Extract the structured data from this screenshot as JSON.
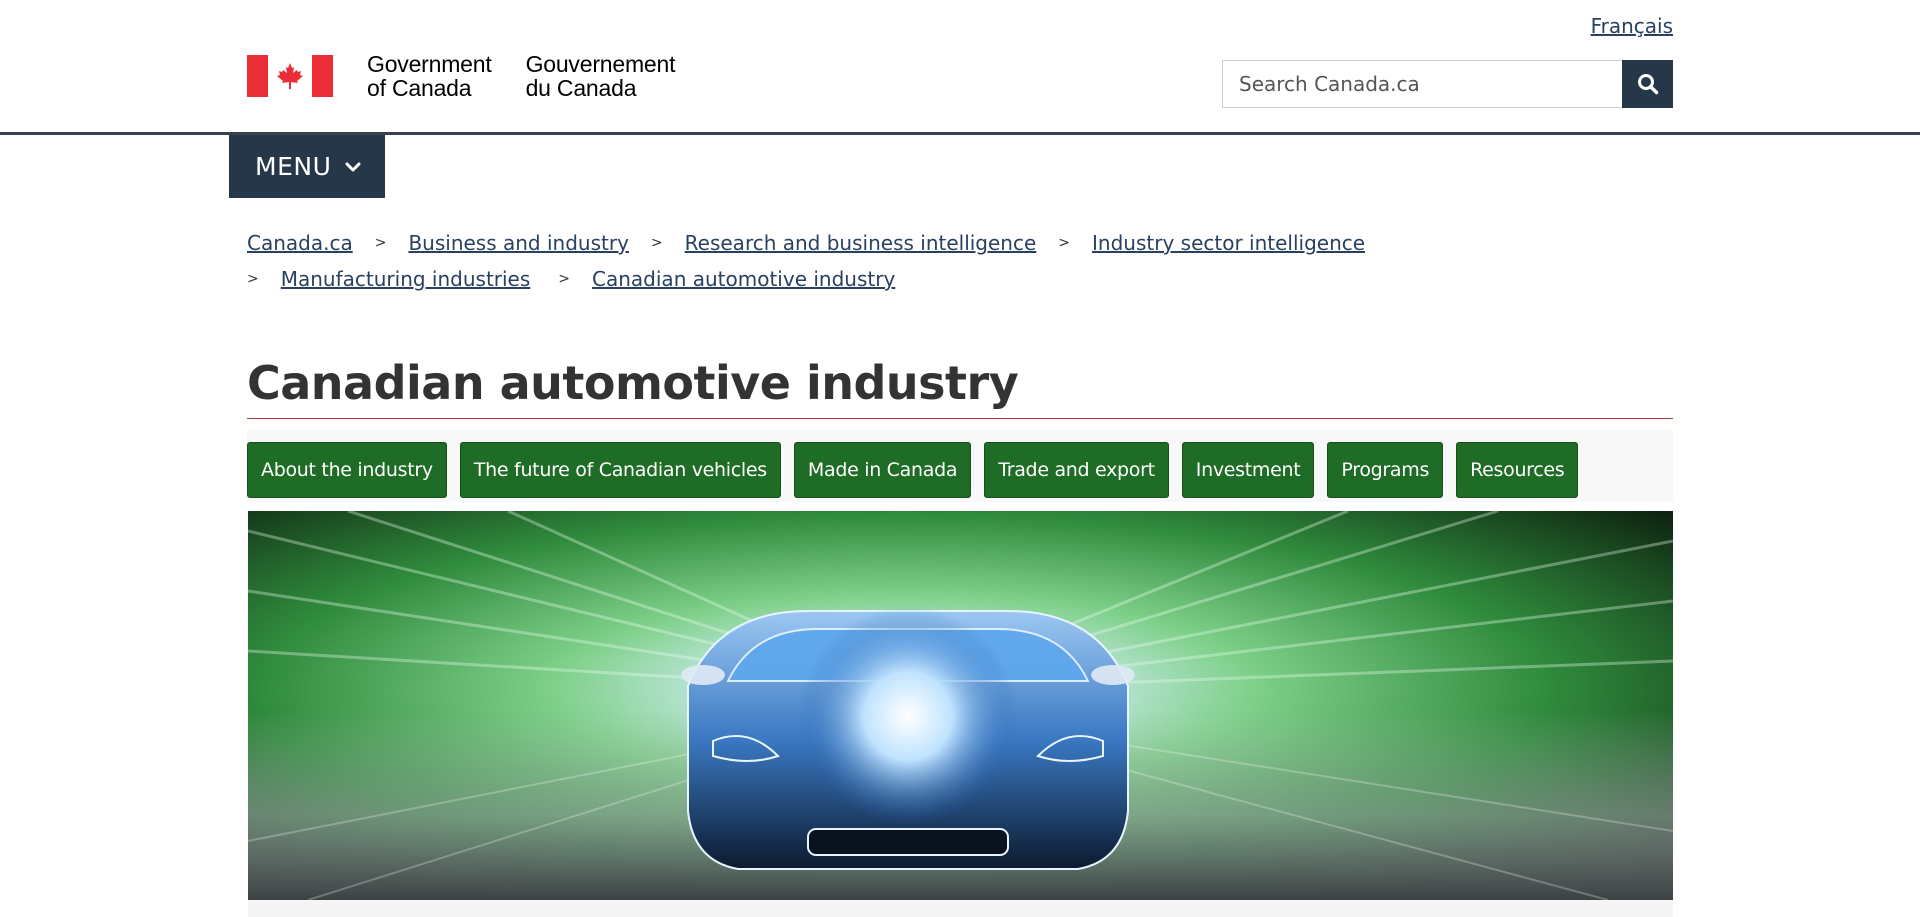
{
  "header": {
    "language_link": "Français",
    "signature_en_line1": "Government",
    "signature_en_line2": "of Canada",
    "signature_fr_line1": "Gouvernement",
    "signature_fr_line2": "du Canada",
    "search_placeholder": "Search Canada.ca",
    "search_icon": "search-icon",
    "colors": {
      "flag_red": "#eb2d37",
      "nav_dark": "#26374a"
    }
  },
  "menu": {
    "label": "MENU",
    "icon": "chevron-down-icon"
  },
  "breadcrumb": [
    "Canada.ca",
    "Business and industry",
    "Research and business intelligence",
    "Industry sector intelligence",
    "Manufacturing industries",
    "Canadian automotive industry"
  ],
  "breadcrumb_separator": ">",
  "page": {
    "title": "Canadian automotive industry"
  },
  "tabs": [
    "About the industry",
    "The future of Canadian vehicles",
    "Made in Canada",
    "Trade and export",
    "Investment",
    "Programs",
    "Resources"
  ],
  "tab_color": "#1e6c26",
  "hero": {
    "image": "car-speed-illustration"
  }
}
